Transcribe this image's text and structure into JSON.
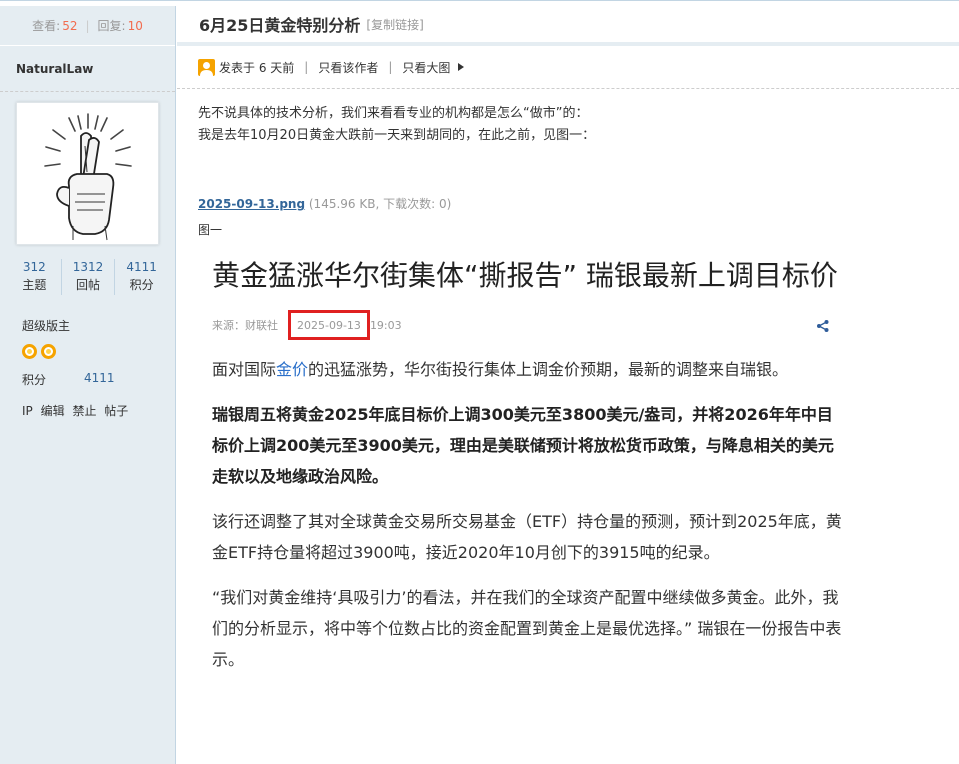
{
  "stats": {
    "views_label": "查看:",
    "views": "52",
    "replies_label": "回复:",
    "replies": "10"
  },
  "author": {
    "name": "NaturalLaw",
    "counts": [
      {
        "value": "312",
        "label": "主题"
      },
      {
        "value": "1312",
        "label": "回帖"
      },
      {
        "value": "4111",
        "label": "积分"
      }
    ],
    "rank": "超级版主",
    "points_label": "积分",
    "points": "4111",
    "actions": [
      "IP",
      "编辑",
      "禁止",
      "帖子"
    ]
  },
  "post": {
    "title": "6月25日黄金特别分析",
    "copy_link": "[复制链接]",
    "posted": "发表于 6 天前",
    "only_author": "只看该作者",
    "only_big_image": "只看大图",
    "body_lines": [
      "先不说具体的技术分析，我们来看看专业的机构都是怎么“做市”的：",
      "我是去年10月20日黄金大跌前一天来到胡同的，在此之前，见图一："
    ],
    "attachment": {
      "filename": "2025-09-13.png",
      "info": "(145.96 KB, 下载次数: 0)"
    },
    "caption": "图一"
  },
  "article": {
    "title": "黄金猛涨华尔街集体“撕报告” 瑞银最新上调目标价",
    "source": "来源：财联社",
    "date": "2025-09-13",
    "time": "19:03",
    "p1_before": "面对国际",
    "p1_link": "金价",
    "p1_after": "的迅猛涨势，华尔街投行集体上调金价预期，最新的调整来自瑞银。",
    "p2": "瑞银周五将黄金2025年底目标价上调300美元至3800美元/盎司，并将2026年年中目标价上调200美元至3900美元，理由是美联储预计将放松货币政策，与降息相关的美元走软以及地缘政治风险。",
    "p3": "该行还调整了其对全球黄金交易所交易基金（ETF）持仓量的预测，预计到2025年底，黄金ETF持仓量将超过3900吨，接近2020年10月创下的3915吨的纪录。",
    "p4": "“我们对黄金维持‘具吸引力’的看法，并在我们的全球资产配置中继续做多黄金。此外，我们的分析显示，将中等个位数占比的资金配置到黄金上是最优选择。” 瑞银在一份报告中表示。"
  },
  "colors": {
    "sidebar_bg": "#e5edf2",
    "count_blue": "#336699",
    "stat_orange": "#f26c4f",
    "highlight_red": "#e02020"
  }
}
